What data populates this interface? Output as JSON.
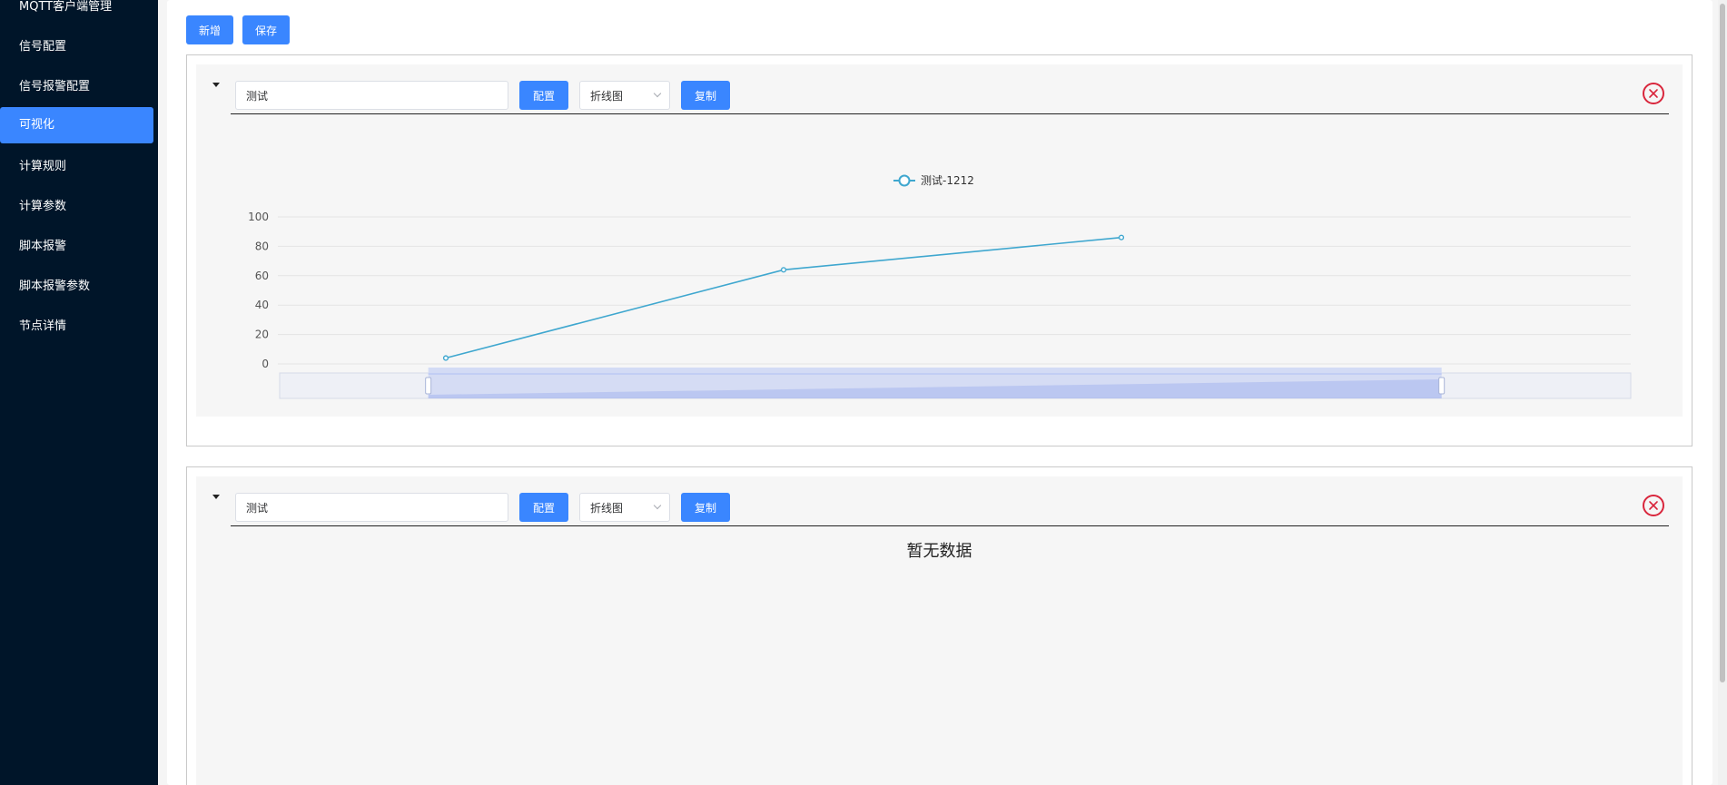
{
  "sidebar": {
    "items": [
      {
        "label": "MQTT客户端管理"
      },
      {
        "label": "信号配置"
      },
      {
        "label": "信号报警配置"
      },
      {
        "label": "可视化"
      },
      {
        "label": "计算规则"
      },
      {
        "label": "计算参数"
      },
      {
        "label": "脚本报警"
      },
      {
        "label": "脚本报警参数"
      },
      {
        "label": "节点详情"
      }
    ],
    "active": "可视化"
  },
  "actions": {
    "add_label": "新增",
    "save_label": "保存"
  },
  "panels": [
    {
      "name_value": "测试",
      "config_label": "配置",
      "chart_type_selected": "折线图",
      "copy_label": "复制"
    },
    {
      "name_value": "测试",
      "config_label": "配置",
      "chart_type_selected": "折线图",
      "copy_label": "复制",
      "empty_text": "暂无数据"
    }
  ],
  "colors": {
    "sidebar_bg": "#001529",
    "accent": "#3a86ff",
    "series": "#3fa7cf",
    "close": "#d9263c"
  },
  "chart_data": {
    "type": "line",
    "series": [
      {
        "name": "测试-1212",
        "values": [
          4,
          64,
          86
        ]
      }
    ],
    "x": [
      1,
      2,
      3
    ],
    "ylim": [
      0,
      100
    ],
    "y_ticks": [
      "0",
      "20",
      "40",
      "60",
      "80",
      "100"
    ],
    "grid": true,
    "legend": "top-center",
    "data_zoom": {
      "start": 0.11,
      "end": 0.86
    }
  }
}
